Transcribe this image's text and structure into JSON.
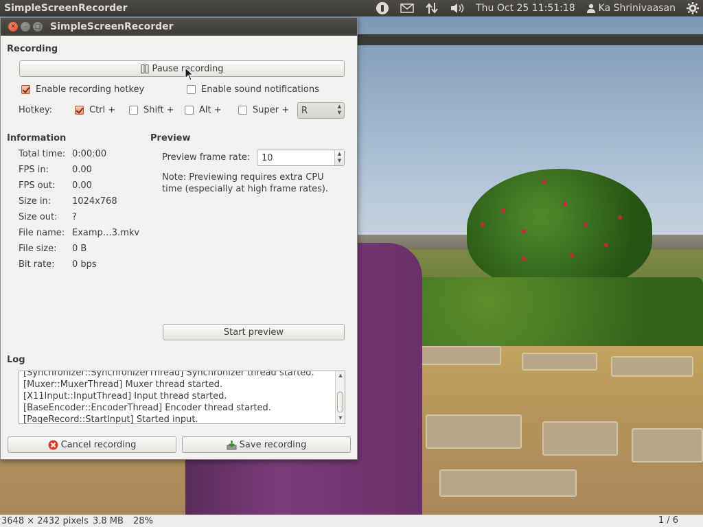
{
  "top_panel": {
    "app_title": "SimpleScreenRecorder",
    "clock": "Thu Oct 25 11:51:18",
    "user": "Ka Shrinivaasan"
  },
  "window": {
    "title": "SimpleScreenRecorder"
  },
  "recording": {
    "section_label": "Recording",
    "pause_button": "Pause recording",
    "enable_hotkey": {
      "label": "Enable recording hotkey",
      "checked": true
    },
    "enable_sound": {
      "label": "Enable sound notifications",
      "checked": false
    },
    "hotkey_label": "Hotkey:",
    "modifiers": [
      {
        "label": "Ctrl +",
        "checked": true
      },
      {
        "label": "Shift +",
        "checked": false
      },
      {
        "label": "Alt +",
        "checked": false
      },
      {
        "label": "Super +",
        "checked": false
      }
    ],
    "hotkey_key": "R"
  },
  "information": {
    "section_label": "Information",
    "rows": [
      {
        "key": "Total time:",
        "value": "0:00:00"
      },
      {
        "key": "FPS in:",
        "value": "0.00"
      },
      {
        "key": "FPS out:",
        "value": "0.00"
      },
      {
        "key": "Size in:",
        "value": "1024x768"
      },
      {
        "key": "Size out:",
        "value": "?"
      },
      {
        "key": "File name:",
        "value": "Examp…3.mkv"
      },
      {
        "key": "File size:",
        "value": "0 B"
      },
      {
        "key": "Bit rate:",
        "value": "0 bps"
      }
    ]
  },
  "preview": {
    "section_label": "Preview",
    "frame_rate_label": "Preview frame rate:",
    "frame_rate_value": "10",
    "note": "Note: Previewing requires extra CPU time (especially at high frame rates).",
    "start_button": "Start preview"
  },
  "log": {
    "section_label": "Log",
    "lines": [
      "[Synchronizer::SynchronizerThread] Synchronizer thread started.",
      "[Muxer::MuxerThread] Muxer thread started.",
      "[X11Input::InputThread] Input thread started.",
      "[BaseEncoder::EncoderThread] Encoder thread started.",
      "[PageRecord::StartInput] Started input."
    ]
  },
  "footer": {
    "cancel_button": "Cancel recording",
    "save_button": "Save recording"
  },
  "viewer_status": {
    "dimensions": "3648 × 2432 pixels",
    "size": "3.8 MB",
    "zoom": "28%",
    "pager": "1 / 6"
  },
  "colors": {
    "panel_bg": "#3c3b37",
    "window_bg": "#f2f1f0",
    "close_button": "#df4a1c",
    "check_accent": "#e79c7f"
  },
  "icons": [
    "indicator-icon",
    "mail-icon",
    "network-icon",
    "volume-icon",
    "user-icon",
    "gear-icon",
    "cancel-icon",
    "save-icon",
    "mouse-cursor-icon"
  ]
}
